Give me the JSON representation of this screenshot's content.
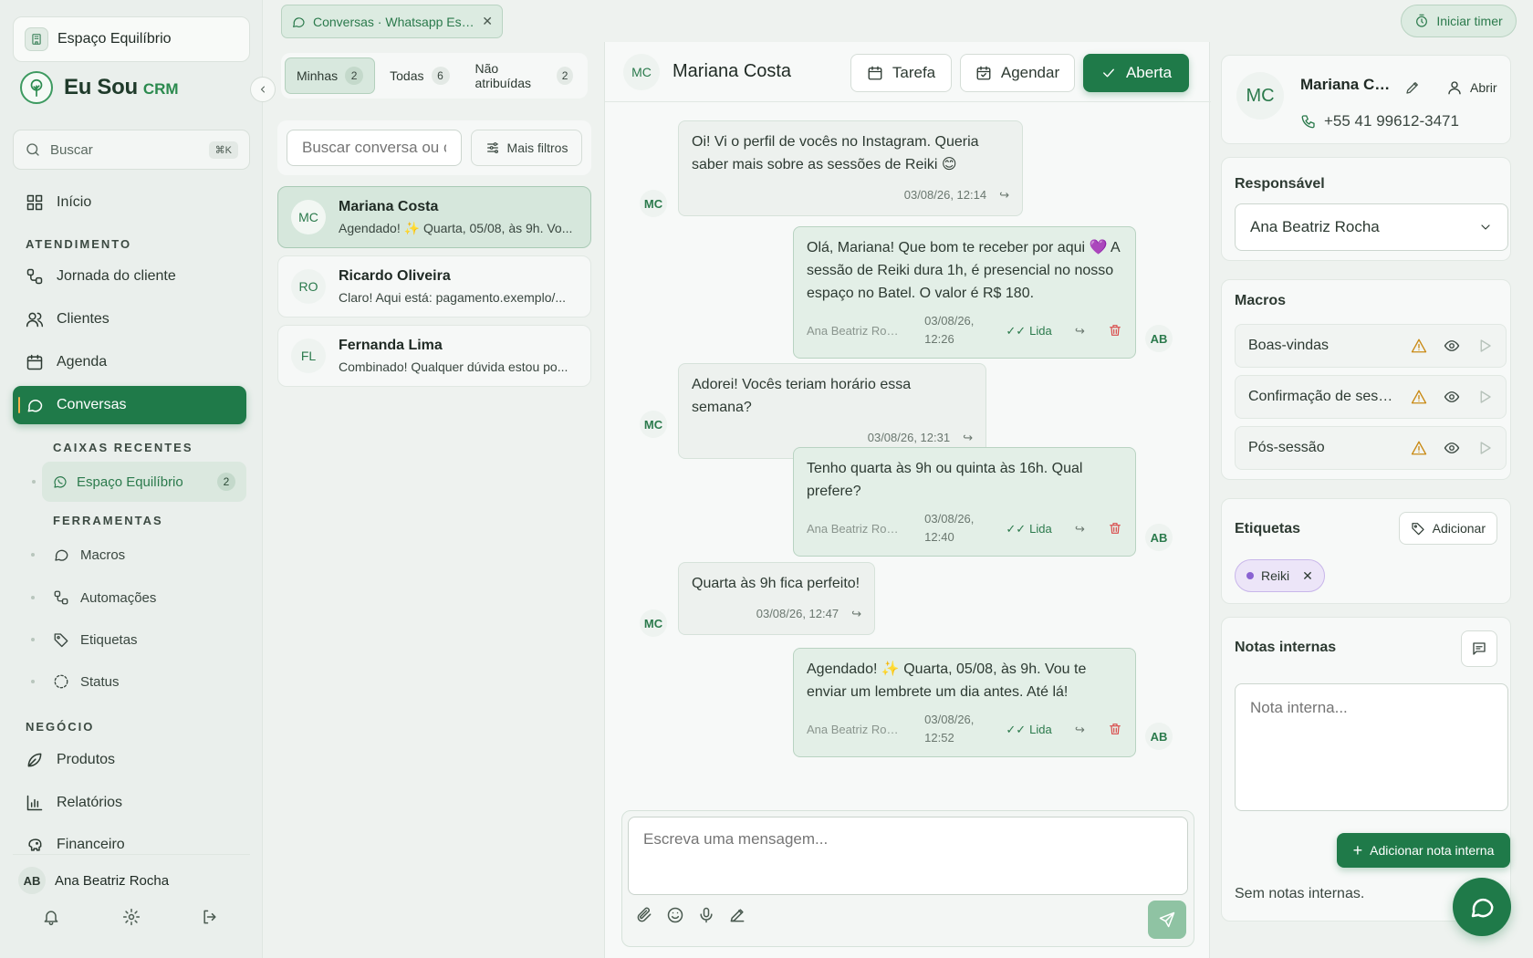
{
  "sidebar": {
    "workspace": "Espaço Equilíbrio",
    "brand": {
      "name": "Eu Sou",
      "suffix": "CRM"
    },
    "search": {
      "placeholder": "Buscar",
      "shortcut": "⌘K"
    },
    "home": "Início",
    "section_atendimento": "ATENDIMENTO",
    "items": [
      "Jornada do cliente",
      "Clientes",
      "Agenda",
      "Conversas"
    ],
    "recent_label": "CAIXAS RECENTES",
    "recent_inbox": {
      "label": "Espaço Equilíbrio",
      "count": "2"
    },
    "tools_label": "FERRAMENTAS",
    "tools": [
      "Macros",
      "Automações",
      "Etiquetas",
      "Status"
    ],
    "section_negocio": "NEGÓCIO",
    "business": [
      "Produtos",
      "Relatórios",
      "Financeiro"
    ],
    "user": {
      "initials": "AB",
      "name": "Ana Beatriz Rocha"
    }
  },
  "top_tab": {
    "label": "Conversas · Whatsapp Es…"
  },
  "timer_button": "Iniciar timer",
  "conversation_list": {
    "filters": [
      {
        "label": "Minhas",
        "count": "2"
      },
      {
        "label": "Todas",
        "count": "6"
      },
      {
        "label": "Não atribuídas",
        "count": "2"
      }
    ],
    "search_placeholder": "Buscar conversa ou c",
    "more_filters": "Mais filtros",
    "conversations": [
      {
        "initials": "MC",
        "name": "Mariana Costa",
        "preview": "Agendado! ✨ Quarta, 05/08, às 9h. Vo..."
      },
      {
        "initials": "RO",
        "name": "Ricardo Oliveira",
        "preview": "Claro! Aqui está: pagamento.exemplo/..."
      },
      {
        "initials": "FL",
        "name": "Fernanda Lima",
        "preview": "Combinado! Qualquer dúvida estou po..."
      }
    ]
  },
  "chat": {
    "contact_initials": "MC",
    "contact_name": "Mariana Costa",
    "task_button": "Tarefa",
    "schedule_button": "Agendar",
    "status_button": "Aberta",
    "messages": [
      {
        "text": "Oi! Vi o perfil de vocês no Instagram. Queria saber mais sobre as sessões de Reiki 😊",
        "time": "03/08/26, 12:14",
        "tag": "MC"
      },
      {
        "text": "Olá, Mariana! Que bom te receber por aqui 💜 A sessão de Reiki dura 1h, é presencial no nosso espaço no Batel. O valor é R$ 180.",
        "sender": "Ana Beatriz Roc...",
        "time_date": "03/08/26,",
        "time_hour": "12:26",
        "status": "Lida",
        "tag": "AB"
      },
      {
        "text": "Adorei! Vocês teriam horário essa semana?",
        "time": "03/08/26, 12:31",
        "tag": "MC"
      },
      {
        "text": "Tenho quarta às 9h ou quinta às 16h. Qual prefere?",
        "sender": "Ana Beatriz Roc...",
        "time_date": "03/08/26,",
        "time_hour": "12:40",
        "status": "Lida",
        "tag": "AB"
      },
      {
        "text": "Quarta às 9h fica perfeito!",
        "time": "03/08/26, 12:47",
        "tag": "MC"
      },
      {
        "text": "Agendado! ✨ Quarta, 05/08, às 9h. Vou te enviar um lembrete um dia antes. Até lá!",
        "sender": "Ana Beatriz Roc...",
        "time_date": "03/08/26,",
        "time_hour": "12:52",
        "status": "Lida",
        "tag": "AB"
      }
    ],
    "composer_placeholder": "Escreva uma mensagem..."
  },
  "contact_panel": {
    "initials": "MC",
    "name": "Mariana Co...",
    "open_label": "Abrir",
    "phone": "+55 41 99612-3471",
    "responsible_label": "Responsável",
    "responsible_value": "Ana Beatriz Rocha",
    "macros_label": "Macros",
    "macros": [
      "Boas-vindas",
      "Confirmação de sess...",
      "Pós-sessão"
    ],
    "tags_label": "Etiquetas",
    "add_tag": "Adicionar",
    "tags": [
      "Reiki"
    ],
    "notes_label": "Notas internas",
    "note_placeholder": "Nota interna...",
    "add_note": "Adicionar nota interna",
    "no_notes": "Sem notas internas."
  },
  "colors": {
    "accent": "#1f7a49",
    "warning": "#c98a16",
    "danger": "#d94a4a",
    "tag": "#8a63d2"
  }
}
